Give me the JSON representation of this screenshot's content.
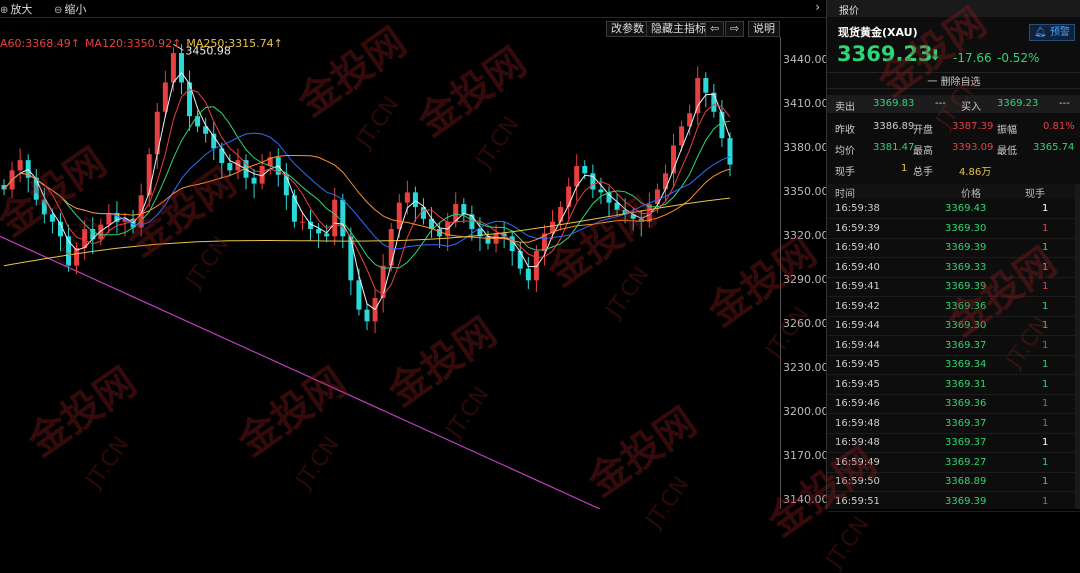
{
  "toolbar": {
    "zoom_in": "放大",
    "zoom_out": "缩小",
    "edit_params": "改参数",
    "hide_indicator": "隐藏主指标",
    "help": "说明"
  },
  "ma_legend": {
    "ma60": "A60:3368.49↑",
    "ma120": "MA120:3350.92↑",
    "ma250": "MA250:3315.74↑"
  },
  "chart_data": {
    "type": "candlestick",
    "yticks": [
      "3440.00",
      "3410.00",
      "3380.00",
      "3350.00",
      "3320.00",
      "3290.00",
      "3260.00",
      "3230.00",
      "3200.00",
      "3170.00",
      "3140.00"
    ],
    "ylim": [
      3134,
      3456
    ],
    "high_marker": "3450.98",
    "closes": [
      3352,
      3365,
      3372,
      3360,
      3345,
      3335,
      3330,
      3320,
      3300,
      3312,
      3325,
      3318,
      3328,
      3336,
      3330,
      3332,
      3326,
      3348,
      3376,
      3405,
      3425,
      3445,
      3425,
      3402,
      3395,
      3390,
      3380,
      3370,
      3365,
      3372,
      3360,
      3356,
      3368,
      3374,
      3362,
      3348,
      3330,
      3330,
      3325,
      3322,
      3320,
      3345,
      3320,
      3290,
      3270,
      3262,
      3278,
      3300,
      3325,
      3343,
      3350,
      3340,
      3332,
      3325,
      3320,
      3330,
      3342,
      3335,
      3325,
      3320,
      3315,
      3322,
      3320,
      3310,
      3298,
      3290,
      3310,
      3322,
      3330,
      3340,
      3354,
      3368,
      3363,
      3352,
      3350,
      3343,
      3338,
      3335,
      3332,
      3330,
      3342,
      3352,
      3363,
      3382,
      3395,
      3404,
      3428,
      3418,
      3405,
      3387,
      3369
    ],
    "colors": {
      "up": "#e84040",
      "down": "#2bd9d9",
      "ma_white": "#f0f0f0",
      "ma_yellow": "#e8c547",
      "ma_green": "#2ed573",
      "ma_blue": "#2e6bff",
      "ma_red": "#e84040",
      "ma_orange": "#ff8c2a",
      "trendline": "#c040c0"
    }
  },
  "panel": {
    "tab_label": "报价",
    "instrument": "现货黄金(XAU)",
    "alert_label": "预警",
    "price": "3369.23",
    "change": "-17.66",
    "change_pct": "-0.52%",
    "watchlist_label": "一 删除自选",
    "quote": {
      "sell_label": "卖出",
      "sell_price": "3369.83",
      "sell_vol": "---",
      "buy_label": "买入",
      "buy_price": "3369.23",
      "buy_vol": "---",
      "prev_close_label": "昨收",
      "prev_close": "3386.89",
      "open_label": "开盘",
      "open": "3387.39",
      "amplitude_label": "振幅",
      "amplitude": "0.81%",
      "avg_label": "均价",
      "avg": "3381.47",
      "high_label": "最高",
      "high": "3393.09",
      "low_label": "最低",
      "low": "3365.74",
      "cur_vol_label": "现手",
      "cur_vol": "1",
      "total_vol_label": "总手",
      "total_vol": "4.86万"
    },
    "table_headers": {
      "time": "时间",
      "price": "价格",
      "vol": "现手"
    },
    "trades": [
      {
        "time": "16:59:38",
        "price": "3369.43",
        "vol": "1",
        "color": "#ffffff"
      },
      {
        "time": "16:59:39",
        "price": "3369.30",
        "vol": "1",
        "color": "#e84040"
      },
      {
        "time": "16:59:40",
        "price": "3369.39",
        "vol": "1",
        "color": "#2ed573"
      },
      {
        "time": "16:59:40",
        "price": "3369.33",
        "vol": "1",
        "color": "#2ed573"
      },
      {
        "time": "16:59:41",
        "price": "3369.39",
        "vol": "1",
        "color": "#e84040"
      },
      {
        "time": "16:59:42",
        "price": "3369.36",
        "vol": "1",
        "color": "#2ed573"
      },
      {
        "time": "16:59:44",
        "price": "3369.30",
        "vol": "1",
        "color": "#2ed573"
      },
      {
        "time": "16:59:44",
        "price": "3369.37",
        "vol": "1",
        "color": "#e84040"
      },
      {
        "time": "16:59:45",
        "price": "3369.34",
        "vol": "1",
        "color": "#2ed573"
      },
      {
        "time": "16:59:45",
        "price": "3369.31",
        "vol": "1",
        "color": "#2ed573"
      },
      {
        "time": "16:59:46",
        "price": "3369.36",
        "vol": "1",
        "color": "#e84040"
      },
      {
        "time": "16:59:48",
        "price": "3369.37",
        "vol": "1",
        "color": "#e84040"
      },
      {
        "time": "16:59:48",
        "price": "3369.37",
        "vol": "1",
        "color": "#ffffff"
      },
      {
        "time": "16:59:49",
        "price": "3369.27",
        "vol": "1",
        "color": "#2ed573"
      },
      {
        "time": "16:59:50",
        "price": "3368.89",
        "vol": "1",
        "color": "#2ed573"
      },
      {
        "time": "16:59:51",
        "price": "3369.39",
        "vol": "1",
        "color": "#e84040"
      }
    ]
  },
  "watermark": {
    "text": "金投网",
    "domain": "JT.CN"
  }
}
